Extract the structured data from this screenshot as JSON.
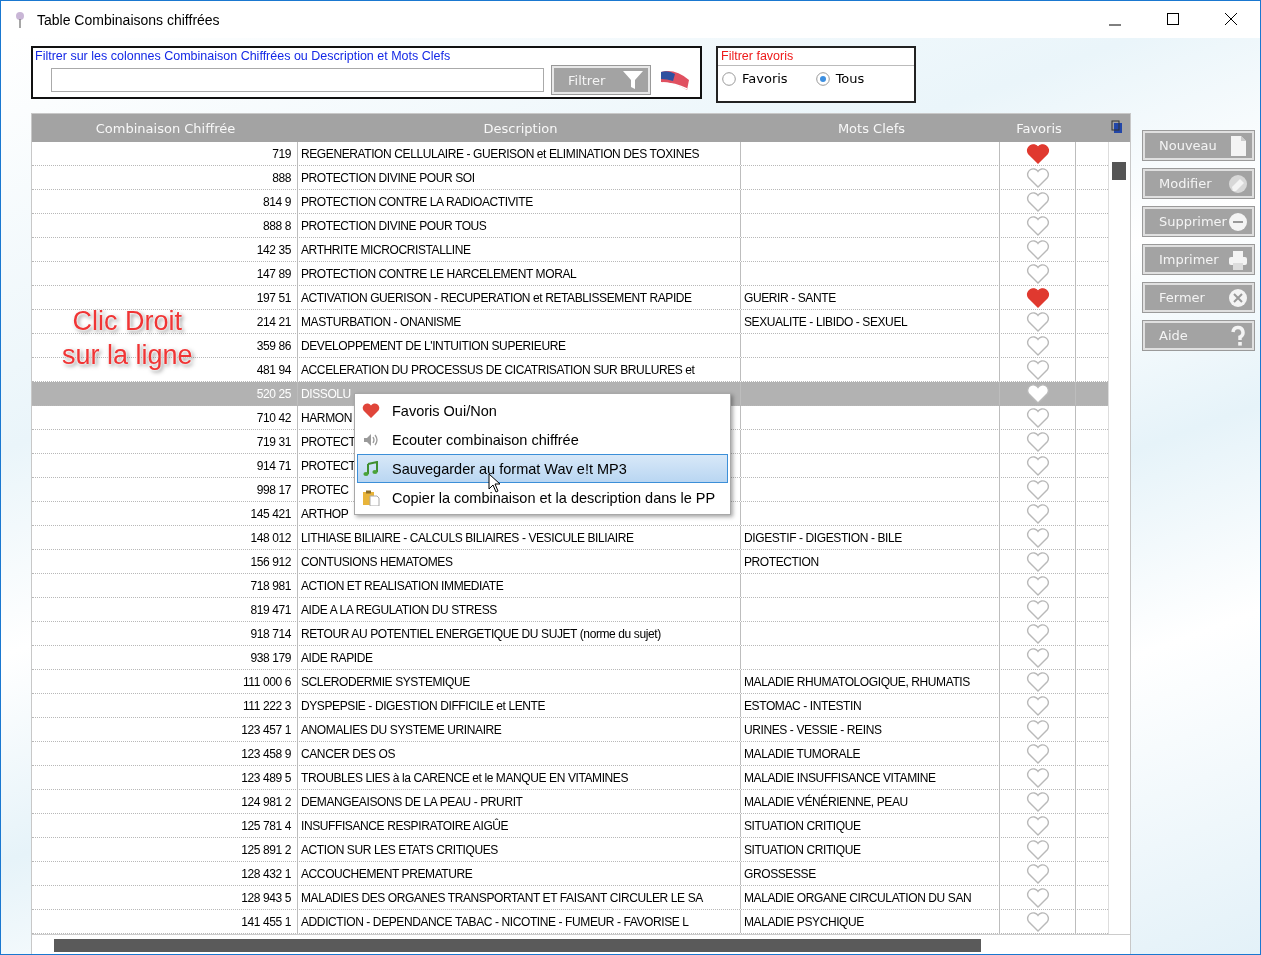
{
  "window": {
    "title": "Table Combinaisons chiffrées"
  },
  "filter": {
    "label": "Filtrer sur les colonnes Combinaison Chiffrées ou Description et Mots Clefs",
    "button": "Filtrer"
  },
  "favorites_filter": {
    "label": "Filtrer favoris",
    "options": [
      {
        "label": "Favoris",
        "selected": false
      },
      {
        "label": "Tous",
        "selected": true
      }
    ]
  },
  "table": {
    "columns": [
      "Combinaison Chiffrée",
      "Description",
      "Mots Clefs",
      "Favoris"
    ],
    "rows": [
      {
        "code": "719",
        "description": "REGENERATION CELLULAIRE - GUERISON et ELIMINATION DES TOXINES",
        "keywords": "",
        "favorite": true,
        "selected": false
      },
      {
        "code": "888",
        "description": "PROTECTION DIVINE POUR SOI",
        "keywords": "",
        "favorite": false,
        "selected": false
      },
      {
        "code": "814 9",
        "description": "PROTECTION CONTRE LA RADIOACTIVITE",
        "keywords": "",
        "favorite": false,
        "selected": false
      },
      {
        "code": "888 8",
        "description": "PROTECTION DIVINE POUR TOUS",
        "keywords": "",
        "favorite": false,
        "selected": false
      },
      {
        "code": "142 35",
        "description": "ARTHRITE MICROCRISTALLINE",
        "keywords": "",
        "favorite": false,
        "selected": false
      },
      {
        "code": "147 89",
        "description": "PROTECTION CONTRE LE HARCELEMENT MORAL",
        "keywords": "",
        "favorite": false,
        "selected": false
      },
      {
        "code": "197 51",
        "description": "ACTIVATION GUERISON - RECUPERATION et RETABLISSEMENT RAPIDE",
        "keywords": "GUERIR - SANTE",
        "favorite": true,
        "selected": false
      },
      {
        "code": "214 21",
        "description": "MASTURBATION - ONANISME",
        "keywords": "SEXUALITE - LIBIDO - SEXUEL",
        "favorite": false,
        "selected": false
      },
      {
        "code": "359 86",
        "description": "DEVELOPPEMENT DE L'INTUITION SUPERIEURE",
        "keywords": "",
        "favorite": false,
        "selected": false
      },
      {
        "code": "481 94",
        "description": "ACCELERATION DU PROCESSUS DE CICATRISATION SUR BRULURES et",
        "keywords": "",
        "favorite": false,
        "selected": false
      },
      {
        "code": "520 25",
        "description": "DISSOLU",
        "keywords": "",
        "favorite": false,
        "selected": true
      },
      {
        "code": "710 42",
        "description": "HARMON",
        "keywords": "",
        "favorite": false,
        "selected": false
      },
      {
        "code": "719 31",
        "description": "PROTECT",
        "keywords": "",
        "favorite": false,
        "selected": false
      },
      {
        "code": "914 71",
        "description": "PROTECT",
        "keywords": "",
        "favorite": false,
        "selected": false
      },
      {
        "code": "998 17",
        "description": "PROTEC",
        "keywords": "",
        "favorite": false,
        "selected": false
      },
      {
        "code": "145 421",
        "description": "ARTHOP",
        "keywords": "",
        "favorite": false,
        "selected": false
      },
      {
        "code": "148 012",
        "description": "LITHIASE BILIAIRE - CALCULS BILIAIRES - VESICULE BILIAIRE",
        "keywords": "DIGESTIF - DIGESTION - BILE",
        "favorite": false,
        "selected": false
      },
      {
        "code": "156 912",
        "description": "CONTUSIONS HEMATOMES",
        "keywords": "PROTECTION",
        "favorite": false,
        "selected": false
      },
      {
        "code": "718 981",
        "description": "ACTION ET REALISATION IMMEDIATE",
        "keywords": "",
        "favorite": false,
        "selected": false
      },
      {
        "code": "819 471",
        "description": "AIDE A LA REGULATION DU STRESS",
        "keywords": "",
        "favorite": false,
        "selected": false
      },
      {
        "code": "918 714",
        "description": "RETOUR AU POTENTIEL ENERGETIQUE DU SUJET (norme du sujet)",
        "keywords": "",
        "favorite": false,
        "selected": false
      },
      {
        "code": "938 179",
        "description": "AIDE RAPIDE",
        "keywords": "",
        "favorite": false,
        "selected": false
      },
      {
        "code": "111 000 6",
        "description": "SCLERODERMIE SYSTEMIQUE",
        "keywords": "MALADIE RHUMATOLOGIQUE, RHUMATIS",
        "favorite": false,
        "selected": false
      },
      {
        "code": "111 222 3",
        "description": "DYSPEPSIE - DIGESTION DIFFICILE et LENTE",
        "keywords": "ESTOMAC - INTESTIN",
        "favorite": false,
        "selected": false
      },
      {
        "code": "123 457 1",
        "description": "ANOMALIES DU SYSTEME URINAIRE",
        "keywords": "URINES - VESSIE - REINS",
        "favorite": false,
        "selected": false
      },
      {
        "code": "123 458 9",
        "description": "CANCER DES OS",
        "keywords": "MALADIE TUMORALE",
        "favorite": false,
        "selected": false
      },
      {
        "code": "123 489 5",
        "description": "TROUBLES LIES à la CARENCE et le MANQUE EN VITAMINES",
        "keywords": "MALADIE INSUFFISANCE VITAMINE",
        "favorite": false,
        "selected": false
      },
      {
        "code": "124 981 2",
        "description": "DEMANGEAISONS DE LA PEAU - PRURIT",
        "keywords": "MALADIE VÉNÉRIENNE, PEAU",
        "favorite": false,
        "selected": false
      },
      {
        "code": "125 781 4",
        "description": "INSUFFISANCE RESPIRATOIRE AIGÛE",
        "keywords": "SITUATION CRITIQUE",
        "favorite": false,
        "selected": false
      },
      {
        "code": "125 891 2",
        "description": "ACTION SUR LES ETATS CRITIQUES",
        "keywords": "SITUATION CRITIQUE",
        "favorite": false,
        "selected": false
      },
      {
        "code": "128 432 1",
        "description": "ACCOUCHEMENT PREMATURE",
        "keywords": "GROSSESSE",
        "favorite": false,
        "selected": false
      },
      {
        "code": "128 943 5",
        "description": "MALADIES DES ORGANES TRANSPORTANT ET FAISANT CIRCULER LE SA",
        "keywords": "MALADIE ORGANE CIRCULATION DU SAN",
        "favorite": false,
        "selected": false
      },
      {
        "code": "141 455 1",
        "description": "ADDICTION - DEPENDANCE TABAC - NICOTINE - FUMEUR - FAVORISE L",
        "keywords": "MALADIE PSYCHIQUE",
        "favorite": false,
        "selected": false
      }
    ]
  },
  "context_menu": {
    "items": [
      {
        "kind": "heart",
        "label": "Favoris Oui/Non",
        "selected": false
      },
      {
        "kind": "speaker",
        "label": "Ecouter combinaison chiffrée",
        "selected": false
      },
      {
        "kind": "music",
        "label": "Sauvegarder au format Wav e!t MP3",
        "selected": true
      },
      {
        "kind": "clipboard",
        "label": "Copier la combinaison et la description dans le PP",
        "selected": false
      }
    ]
  },
  "overlay_note": {
    "lines": [
      "Clic Droit",
      "sur la ligne"
    ]
  },
  "actions": [
    {
      "kind": "new",
      "label": "Nouveau"
    },
    {
      "kind": "edit",
      "label": "Modifier"
    },
    {
      "kind": "delete",
      "label": "Supprimer"
    },
    {
      "kind": "print",
      "label": "Imprimer"
    },
    {
      "kind": "close",
      "label": "Fermer"
    },
    {
      "kind": "help",
      "label": "Aide"
    }
  ]
}
